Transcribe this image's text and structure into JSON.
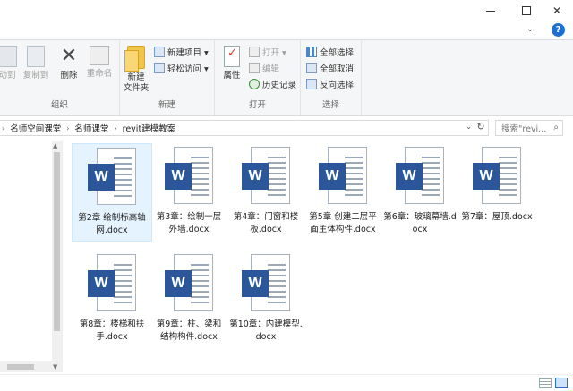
{
  "window": {
    "minimize_icon": "minimize-icon",
    "maximize_icon": "maximize-icon",
    "close_label": "✕"
  },
  "tabs_row": {
    "expand_glyph": "⌄",
    "help_label": "?"
  },
  "ribbon": {
    "organize": {
      "label": "组织",
      "move_to": "动到",
      "copy_to": "复制到",
      "delete": "删除",
      "rename": "重命名"
    },
    "new": {
      "label": "新建",
      "new_folder_line1": "新建",
      "new_folder_line2": "文件夹",
      "new_item": "新建项目 ▾",
      "easy_access": "轻松访问 ▾"
    },
    "open": {
      "label": "打开",
      "properties": "属性",
      "open": "打开 ▾",
      "edit": "编辑",
      "history": "历史记录"
    },
    "select": {
      "label": "选择",
      "select_all": "全部选择",
      "select_none": "全部取消",
      "invert": "反向选择"
    }
  },
  "address": {
    "crumbs": [
      "名师空间课堂",
      "名师课堂",
      "revit建模教案"
    ],
    "separator": "›",
    "dropdown_glyph": "⌄",
    "refresh_glyph": "↻",
    "search_placeholder": "搜索\"revi...",
    "search_glyph": "⌕"
  },
  "files": [
    {
      "name": "第2章 绘制标高轴网.docx",
      "icon": "word-document-icon"
    },
    {
      "name": "第3章：绘制一层外墙.docx",
      "icon": "word-document-icon"
    },
    {
      "name": "第4章：门窗和楼板.docx",
      "icon": "word-document-icon"
    },
    {
      "name": "第5章 创建二层平面主体构件.docx",
      "icon": "word-document-icon"
    },
    {
      "name": "第6章：玻璃幕墙.docx",
      "icon": "word-document-icon"
    },
    {
      "name": "第7章：屋顶.docx",
      "icon": "word-document-icon"
    },
    {
      "name": "第8章：楼梯和扶手.docx",
      "icon": "word-document-icon"
    },
    {
      "name": "第9章：柱、梁和结构构件.docx",
      "icon": "word-document-icon"
    },
    {
      "name": "第10章：内建模型.docx",
      "icon": "word-document-icon"
    }
  ],
  "file_icon_letter": "W",
  "colors": {
    "word_blue": "#2b579a",
    "selection": "#e5f3ff",
    "help_blue": "#1f6fd1"
  }
}
